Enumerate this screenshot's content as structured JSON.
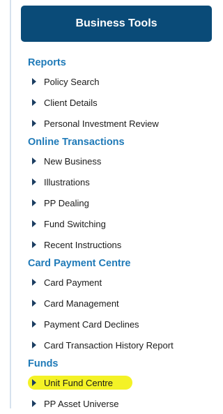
{
  "header": {
    "title": "Business Tools"
  },
  "sections": [
    {
      "title": "Reports",
      "items": [
        "Policy Search",
        "Client Details",
        "Personal Investment Review"
      ]
    },
    {
      "title": "Online Transactions",
      "items": [
        "New Business",
        "Illustrations",
        "PP Dealing",
        "Fund Switching",
        "Recent Instructions"
      ]
    },
    {
      "title": "Card Payment Centre",
      "items": [
        "Card Payment",
        "Card Management",
        "Payment Card Declines",
        "Card Transaction History Report"
      ]
    },
    {
      "title": "Funds",
      "items": [
        "Unit Fund Centre",
        "PP Asset Universe"
      ]
    }
  ],
  "highlighted_item": "Unit Fund Centre",
  "colors": {
    "header_bg": "#0a4b78",
    "section_title": "#1f7ab8",
    "highlight": "#f4f226"
  },
  "icons": {
    "item_bullet": "right-triangle-icon"
  }
}
